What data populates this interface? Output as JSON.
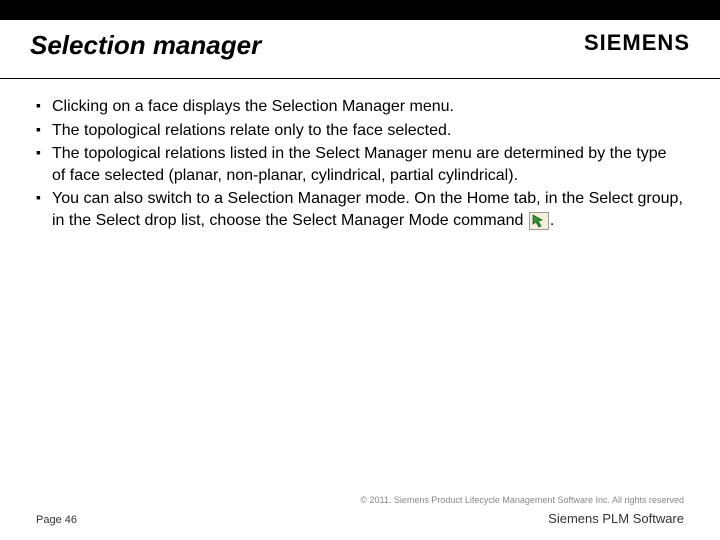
{
  "header": {
    "title": "Selection manager",
    "brand": "SIEMENS"
  },
  "bullets": [
    "Clicking on a face displays the Selection Manager menu.",
    "The topological relations relate only to the face selected.",
    "The topological relations listed in the Select Manager menu are determined by the type of face selected (planar, non-planar, cylindrical, partial cylindrical).",
    "You can also switch to a Selection Manager mode. On the Home tab, in the Select group, in the Select drop list, choose the Select Manager Mode command "
  ],
  "bullet_trailing_period": ".",
  "footer": {
    "copyright": "© 2011. Siemens Product Lifecycle Management Software Inc. All rights reserved",
    "page": "Page 46",
    "product": "Siemens PLM Software"
  }
}
